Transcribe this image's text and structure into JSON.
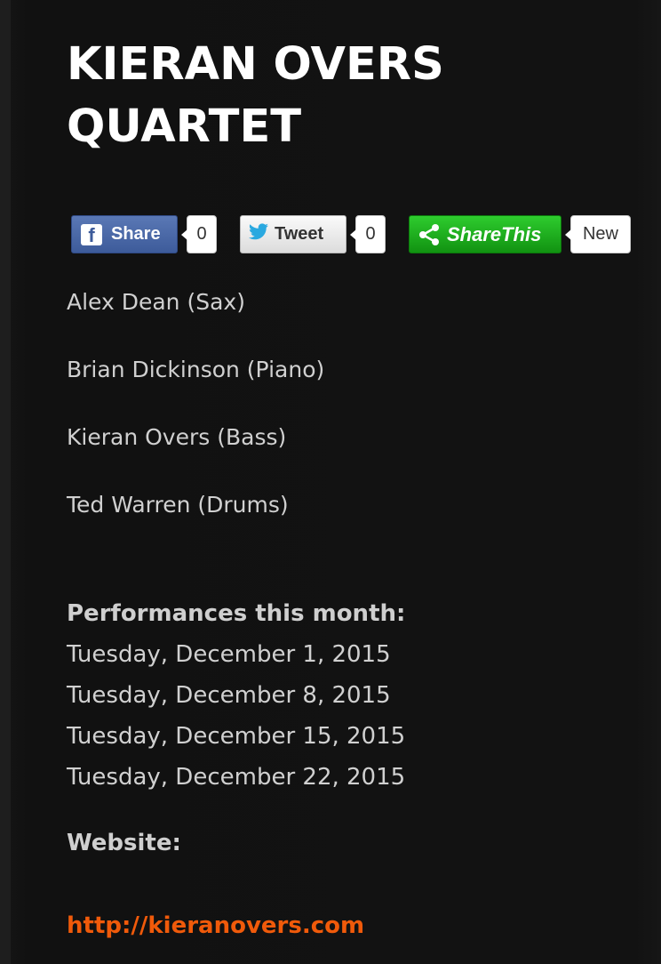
{
  "band": {
    "title_line1": "KIERAN OVERS",
    "title_line2": "QUARTET"
  },
  "social": {
    "facebook_label": "Share",
    "facebook_count": "0",
    "twitter_label": "Tweet",
    "twitter_count": "0",
    "sharethis_label": "ShareThis",
    "sharethis_badge": "New",
    "facebook_color": "#3d5b9a",
    "sharethis_color": "#119211"
  },
  "members": [
    "Alex Dean (Sax)",
    "Brian Dickinson (Piano)",
    "Kieran Overs (Bass)",
    "Ted Warren (Drums)"
  ],
  "performances": {
    "heading": "Performances this month:",
    "dates": [
      "Tuesday, December 1, 2015",
      "Tuesday, December 8, 2015",
      "Tuesday, December 15, 2015",
      "Tuesday, December 22, 2015"
    ]
  },
  "website": {
    "label": "Website:",
    "url_text": "http://kieranovers.com",
    "link_color": "#f05a0a"
  }
}
